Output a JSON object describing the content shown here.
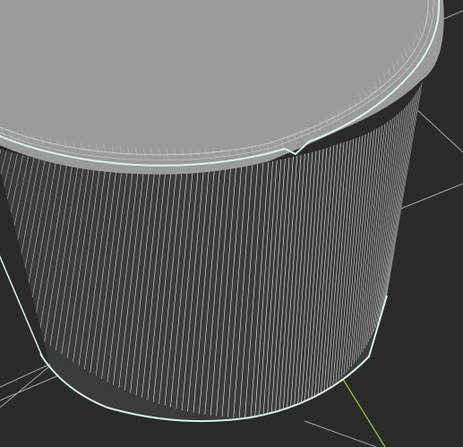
{
  "viewport": {
    "background": "#2b2b2b",
    "grid_color": "#a8a8a8",
    "y_axis_color": "#8cc63f",
    "mesh_fill": "#3c3c3c",
    "cap_fill": "#9b9b9b",
    "wire_color": "#ffffff",
    "edge_color": "#d8f3e6",
    "wire_density": 100,
    "object": "cylinder",
    "mode": "wireframe-overlay"
  }
}
